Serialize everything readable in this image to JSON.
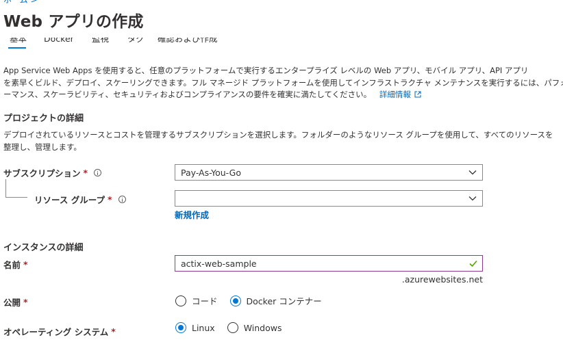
{
  "breadcrumb": "ホーム >",
  "page_title": "Web アプリの作成",
  "tabs": [
    "基本",
    "Docker",
    "監視",
    "タグ",
    "確認および作成"
  ],
  "intro": {
    "line1": "App Service Web Apps を使用すると、任意のプラットフォームで実行するエンタープライズ レベルの Web アプリ、モバイル アプリ、API アプリ",
    "line2": "を素早くビルド、デプロイ、スケーリングできます。フル マネージド プラットフォームを使用してインフラストラクチャ メンテナンスを実行するには、パフォ",
    "line3": "ーマンス、スケーラビリティ、セキュリティおよびコンプライアンスの要件を確実に満たしてください。",
    "learn_more": "詳細情報"
  },
  "project": {
    "title": "プロジェクトの詳細",
    "desc_line1": "デプロイされているリソースとコストを管理するサブスクリプションを選択します。フォルダーのようなリソース グループを使用して、すべてのリソースを",
    "desc_line2": "整理し、管理します。",
    "subscription_label": "サブスクリプション",
    "subscription_value": "Pay-As-You-Go",
    "resource_group_label": "リソース グループ",
    "resource_group_value": "",
    "create_new": "新規作成"
  },
  "instance": {
    "title": "インスタンスの詳細",
    "name_label": "名前",
    "name_value": "actix-web-sample",
    "name_suffix": ".azurewebsites.net",
    "publish_label": "公開",
    "publish_options": [
      "コード",
      "Docker コンテナー"
    ],
    "publish_selected": "Docker コンテナー",
    "os_label": "オペレーティング システム",
    "os_options": [
      "Linux",
      "Windows"
    ],
    "os_selected": "Linux"
  },
  "required_mark": "*",
  "colors": {
    "accent": "#0078d4",
    "link": "#0067b8",
    "required": "#a4262c",
    "valid_border": "#8c3a8c",
    "valid_check": "#57a300"
  }
}
